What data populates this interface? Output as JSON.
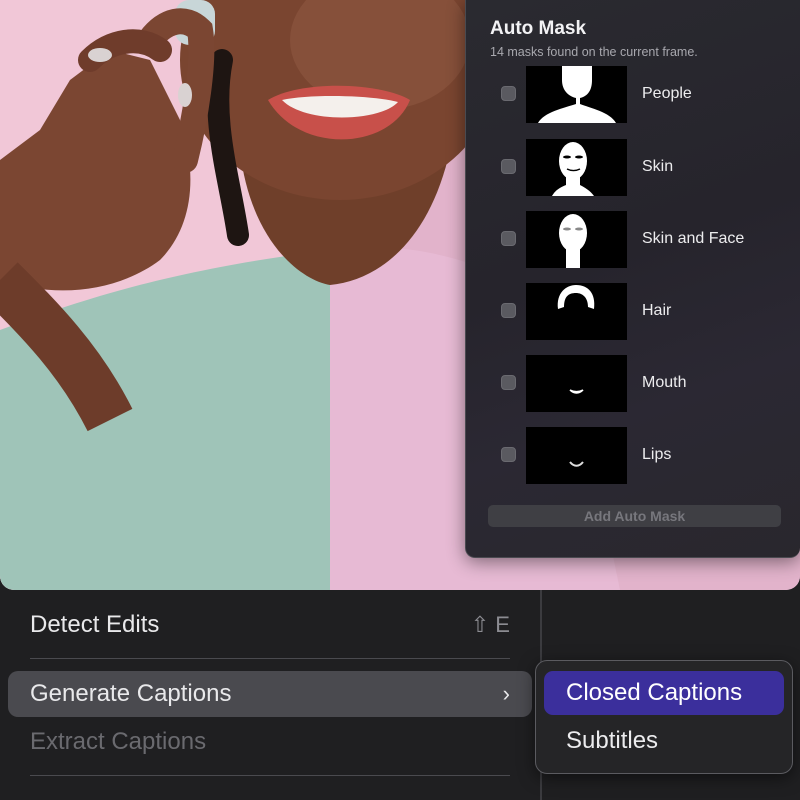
{
  "auto_mask": {
    "title": "Auto Mask",
    "subtitle": "14 masks found on the current frame.",
    "items": [
      {
        "label": "People",
        "checked": false,
        "thumb": "people-silhouette"
      },
      {
        "label": "Skin",
        "checked": false,
        "thumb": "face-silhouette"
      },
      {
        "label": "Skin and Face",
        "checked": false,
        "thumb": "face-features-silhouette"
      },
      {
        "label": "Hair",
        "checked": false,
        "thumb": "hair-silhouette"
      },
      {
        "label": "Mouth",
        "checked": false,
        "thumb": "mouth-silhouette"
      },
      {
        "label": "Lips",
        "checked": false,
        "thumb": "lips-silhouette"
      }
    ],
    "add_button": "Add Auto Mask"
  },
  "context_menu": {
    "items": [
      {
        "label": "Detect Edits",
        "shortcut": "⇧ E",
        "enabled": true
      },
      {
        "label": "Generate Captions",
        "submenu": true,
        "enabled": true,
        "highlighted": true
      },
      {
        "label": "Extract Captions",
        "enabled": false
      }
    ],
    "submenu": {
      "items": [
        {
          "label": "Closed Captions",
          "selected": true
        },
        {
          "label": "Subtitles",
          "selected": false
        }
      ]
    },
    "chevron_icon": "›"
  },
  "colors": {
    "menu_selected": "#3b2f9c",
    "panel_bg": "#2a2a30",
    "photo_bg": "#e9b7cf"
  }
}
